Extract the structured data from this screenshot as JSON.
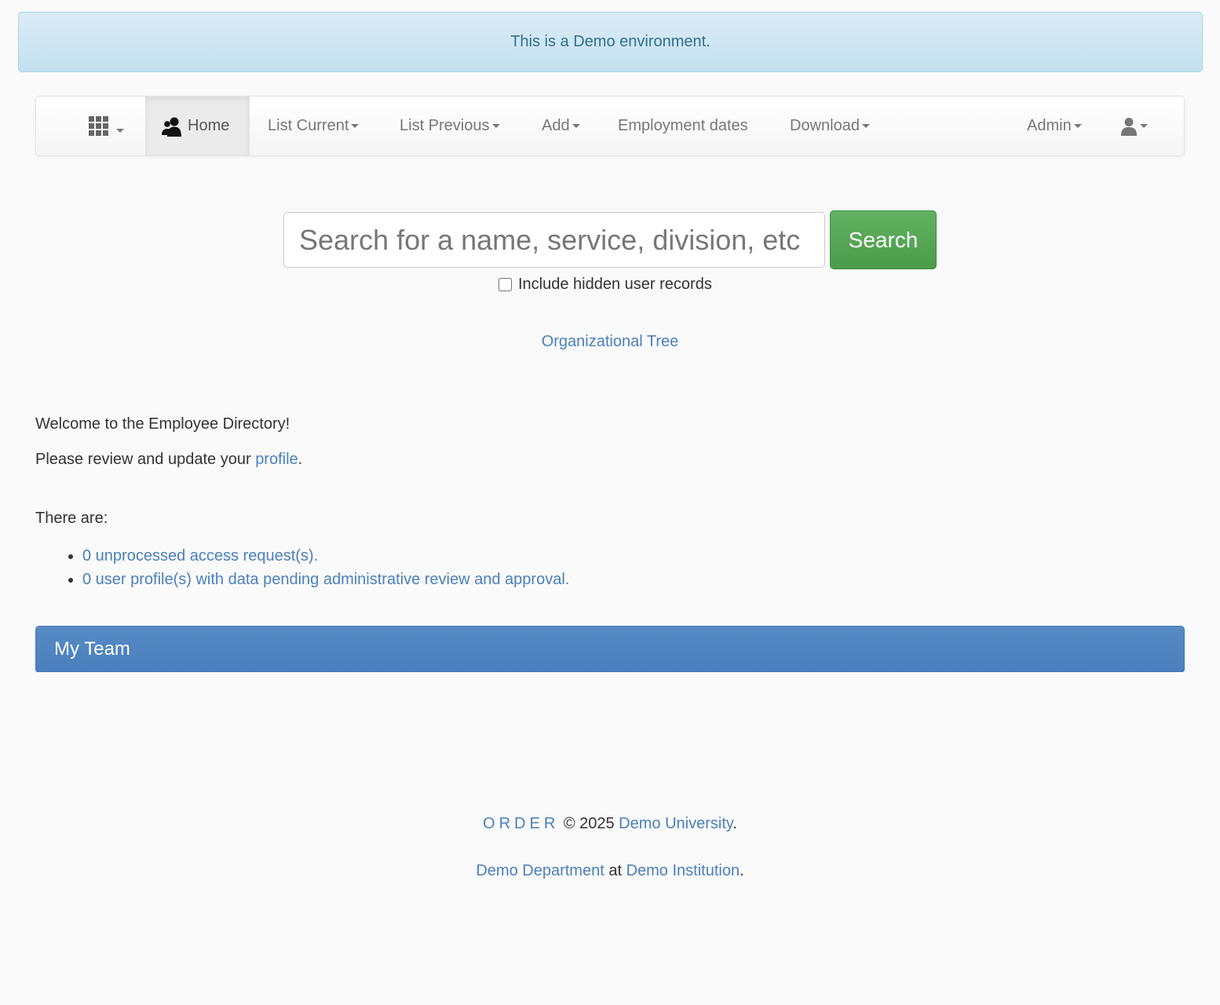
{
  "banner": {
    "text": "This is a Demo environment."
  },
  "nav": {
    "home": "Home",
    "list_current": "List Current",
    "list_previous": "List Previous",
    "add": "Add",
    "employment_dates": "Employment dates",
    "download": "Download",
    "admin": "Admin",
    "icons": [
      "apps-grid-icon",
      "users-icon",
      "user-icon"
    ]
  },
  "search": {
    "placeholder": "Search for a name, service, division, etc",
    "value": "",
    "button_label": "Search",
    "include_hidden_label": "Include hidden user records",
    "include_hidden_checked": false
  },
  "links": {
    "org_tree": "Organizational Tree"
  },
  "content": {
    "welcome": "Welcome to the Employee Directory!",
    "review_prefix": "Please review and update your ",
    "review_link": "profile",
    "review_suffix": ".",
    "there_are": "There are:",
    "items": [
      "0 unprocessed access request(s).",
      "0 user profile(s) with data pending administrative review and approval."
    ]
  },
  "team_panel": {
    "title": "My Team"
  },
  "footer": {
    "order": "ORDER",
    "copyright": " © 2025 ",
    "university": "Demo University",
    "period1": ".",
    "department": "Demo Department",
    "at": " at ",
    "institution": "Demo Institution",
    "period2": "."
  },
  "colors": {
    "link": "#4a80bd",
    "search_button": "#5cb85c",
    "panel_heading": "#4f85c2",
    "banner_bg": "#d2e7f3",
    "banner_text": "#31708f"
  }
}
